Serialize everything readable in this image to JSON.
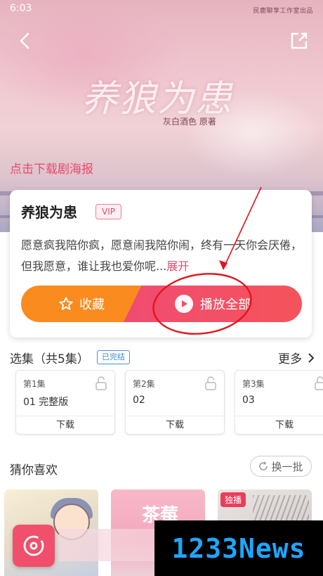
{
  "status_bar": {
    "time": "6:03",
    "right_text": "民鹿聊享工作室出品"
  },
  "poster": {
    "title_art": "养狼为患",
    "author_line": "灰白酒色  原著",
    "download_label": "点击下载剧海报"
  },
  "drama": {
    "title": "养狼为患",
    "badge": "VIP",
    "description": "愿意疯我陪你疯，愿意闹我陪你闹，终有一天你会厌倦，但我愿意，谁让我也爱你呢...",
    "expand_label": "展开",
    "collect_label": "收藏",
    "play_all_label": "播放全部"
  },
  "episodes": {
    "header": "选集（共5集）",
    "status_badge": "已完结",
    "more_label": "更多",
    "items": [
      {
        "number": "第1集",
        "name": "01 完整版",
        "download": "下载"
      },
      {
        "number": "第2集",
        "name": "02",
        "download": "下载"
      },
      {
        "number": "第3集",
        "name": "03",
        "download": "下载"
      }
    ]
  },
  "recommend": {
    "header": "猜你喜欢",
    "refresh_label": "换一批",
    "items": [
      {
        "badge": ""
      },
      {
        "art_text": "茶莓"
      },
      {
        "badge": "独播"
      }
    ]
  },
  "watermark": "1233News",
  "colors": {
    "accent": "#e8476e",
    "collect_orange": "#fa8b1f",
    "play_red": "#ef4c72",
    "annotation_red": "#e3141c",
    "done_blue": "#3f86d4"
  }
}
